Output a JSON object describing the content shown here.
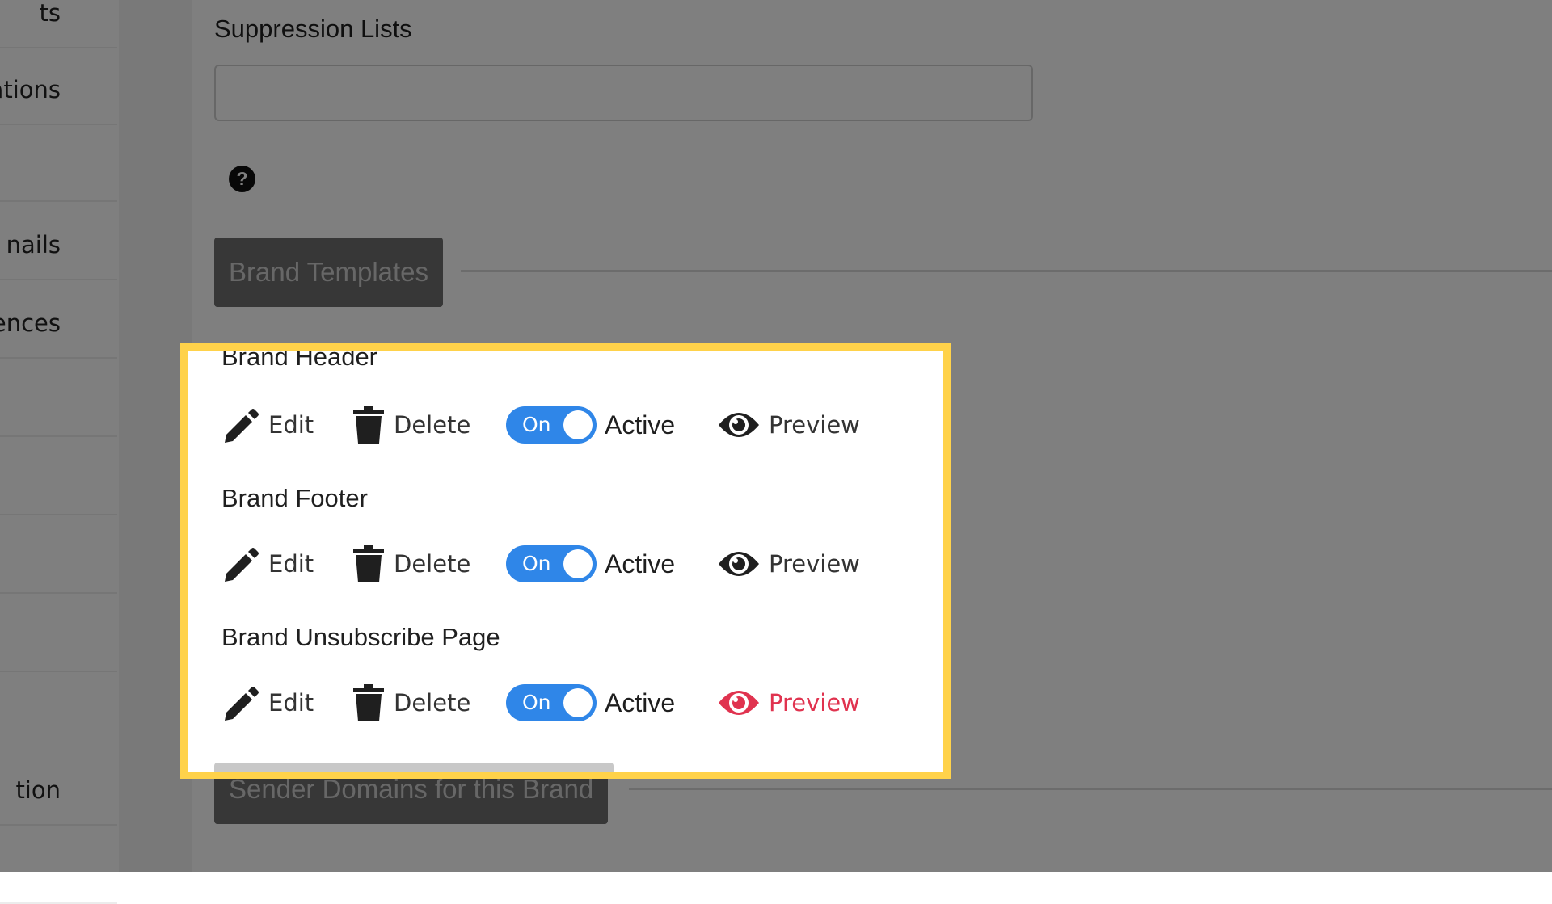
{
  "sidebar": {
    "items": [
      {
        "label": "ts"
      },
      {
        "label": "ations"
      },
      {
        "label": ""
      },
      {
        "label": "nails"
      },
      {
        "label": "ences"
      },
      {
        "label": ""
      },
      {
        "label": ""
      },
      {
        "label": ""
      },
      {
        "label": ""
      },
      {
        "label": "tion"
      },
      {
        "label": ""
      }
    ]
  },
  "suppression": {
    "label": "Suppression Lists",
    "value": ""
  },
  "help": {
    "icon": "question-circle-icon",
    "glyph": "?"
  },
  "brand_templates": {
    "button_label": "Brand Templates"
  },
  "templates": [
    {
      "title": "Brand Header",
      "edit": "Edit",
      "delete": "Delete",
      "toggle": "On",
      "status": "Active",
      "preview": "Preview"
    },
    {
      "title": "Brand Footer",
      "edit": "Edit",
      "delete": "Delete",
      "toggle": "On",
      "status": "Active",
      "preview": "Preview"
    },
    {
      "title": "Brand Unsubscribe Page",
      "edit": "Edit",
      "delete": "Delete",
      "toggle": "On",
      "status": "Active",
      "preview": "Preview"
    }
  ],
  "sender_domains": {
    "button_label": "Sender Domains for this Brand"
  },
  "colors": {
    "toggle_on": "#2f86e8",
    "highlight_border": "#ffd24a",
    "preview_hover": "#e0334f",
    "overlay": "rgba(0,0,0,0.5)"
  }
}
